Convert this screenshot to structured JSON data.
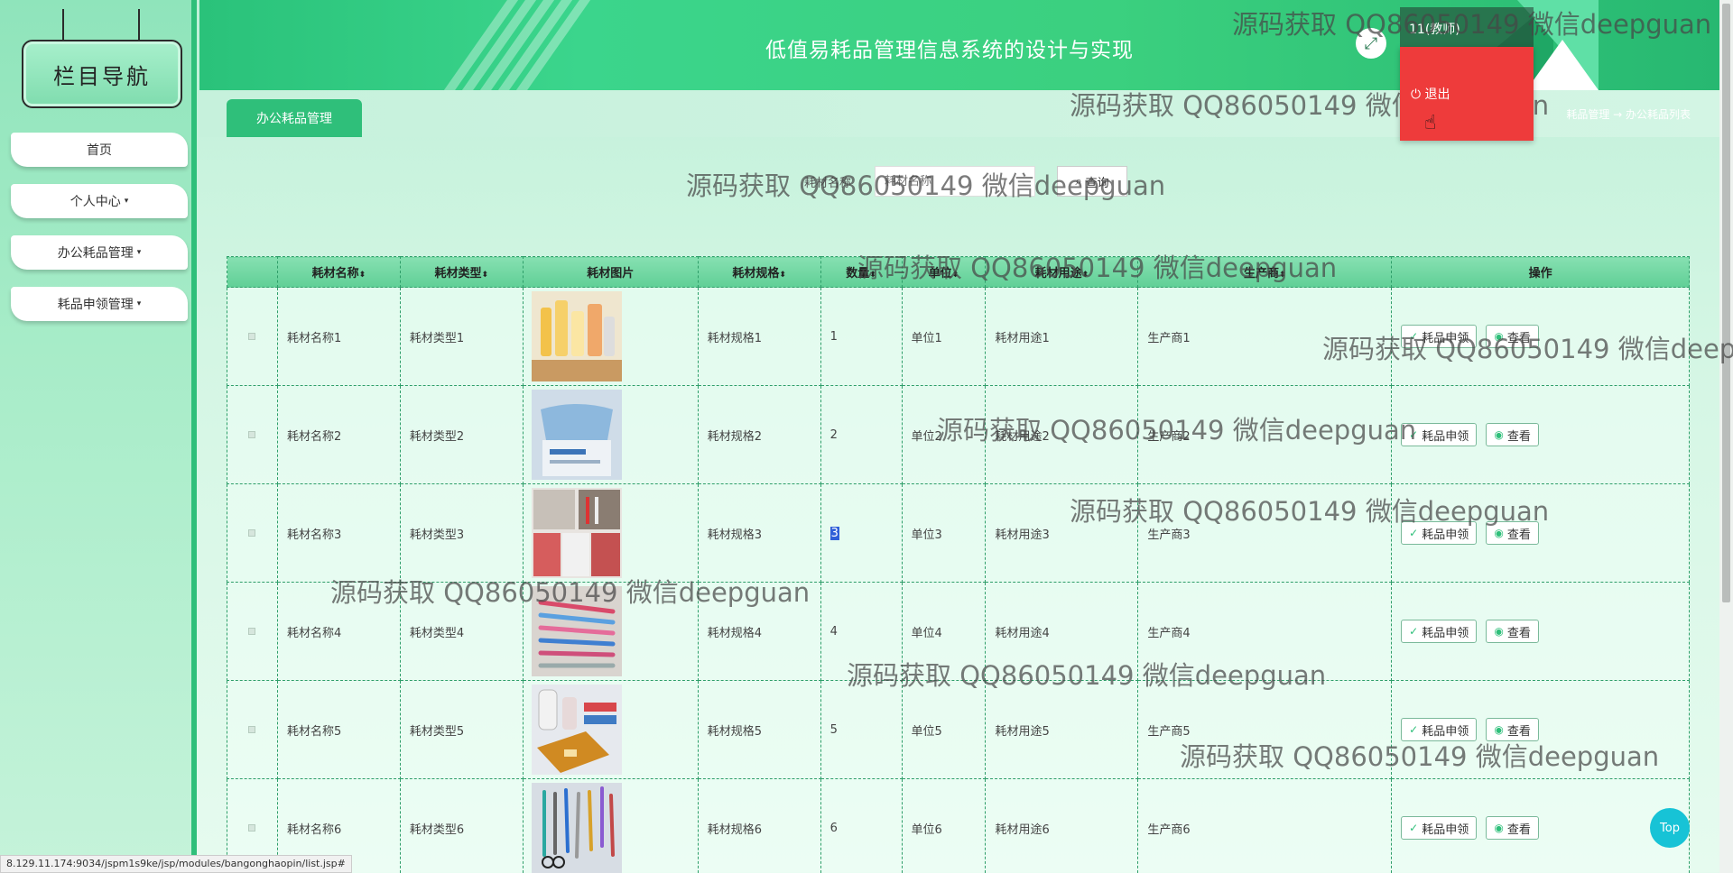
{
  "sidebar": {
    "title": "栏目导航",
    "items": [
      {
        "label": "首页",
        "caret": ""
      },
      {
        "label": "个人中心",
        "caret": "▾"
      },
      {
        "label": "办公耗品管理",
        "caret": "▾"
      },
      {
        "label": "耗品申领管理",
        "caret": "▾"
      }
    ]
  },
  "header": {
    "title": "低值易耗品管理信息系统的设计与实现",
    "user": "11(教师)",
    "logout": "退出"
  },
  "tabs": {
    "active": "办公耗品管理",
    "breadcrumb": "耗品管理 → 办公耗品列表"
  },
  "search": {
    "label": "耗材名称",
    "placeholder": "耗材名称",
    "button": "查询"
  },
  "table": {
    "columns": [
      "",
      "耗材名称",
      "耗材类型",
      "耗材图片",
      "耗材规格",
      "数量",
      "单位",
      "耗材用途",
      "生产商",
      "操作"
    ],
    "rows": [
      {
        "name": "耗材名称1",
        "type": "耗材类型1",
        "spec": "耗材规格1",
        "qty": "1",
        "unit": "单位1",
        "usage": "耗材用途1",
        "maker": "生产商1"
      },
      {
        "name": "耗材名称2",
        "type": "耗材类型2",
        "spec": "耗材规格2",
        "qty": "2",
        "unit": "单位2",
        "usage": "耗材用途2",
        "maker": "生产商2"
      },
      {
        "name": "耗材名称3",
        "type": "耗材类型3",
        "spec": "耗材规格3",
        "qty": "3",
        "unit": "单位3",
        "usage": "耗材用途3",
        "maker": "生产商3"
      },
      {
        "name": "耗材名称4",
        "type": "耗材类型4",
        "spec": "耗材规格4",
        "qty": "4",
        "unit": "单位4",
        "usage": "耗材用途4",
        "maker": "生产商4"
      },
      {
        "name": "耗材名称5",
        "type": "耗材类型5",
        "spec": "耗材规格5",
        "qty": "5",
        "unit": "单位5",
        "usage": "耗材用途5",
        "maker": "生产商5"
      },
      {
        "name": "耗材名称6",
        "type": "耗材类型6",
        "spec": "耗材规格6",
        "qty": "6",
        "unit": "单位6",
        "usage": "耗材用途6",
        "maker": "生产商6"
      }
    ],
    "apply_label": "耗品申领",
    "view_label": "查看"
  },
  "watermark": "源码获取 QQ86050149 微信deepguan",
  "top_button": "Top",
  "status_url": "8.129.11.174:9034/jspm1s9ke/jsp/modules/bangonghaopin/list.jsp#",
  "colors": {
    "primary": "#2fbf7a",
    "user_menu": "#ee3b3b",
    "top_button": "#17c3d6"
  }
}
